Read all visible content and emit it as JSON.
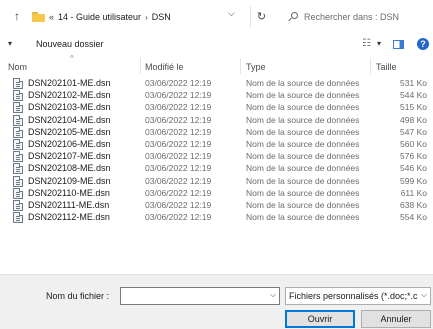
{
  "address": {
    "overflow": "«",
    "crumbs": [
      "14 - Guide utilisateur",
      "DSN"
    ]
  },
  "search": {
    "placeholder": "Rechercher dans : DSN"
  },
  "toolbar": {
    "new_folder": "Nouveau dossier",
    "help": "?"
  },
  "columns": {
    "name": "Nom",
    "modified": "Modifié le",
    "type": "Type",
    "size": "Taille"
  },
  "files": [
    {
      "name": "DSN202101-ME.dsn",
      "modified": "03/06/2022 12:19",
      "type": "Nom de la source de données",
      "size": "531 Ko"
    },
    {
      "name": "DSN202102-ME.dsn",
      "modified": "03/06/2022 12:19",
      "type": "Nom de la source de données",
      "size": "544 Ko"
    },
    {
      "name": "DSN202103-ME.dsn",
      "modified": "03/06/2022 12:19",
      "type": "Nom de la source de données",
      "size": "515 Ko"
    },
    {
      "name": "DSN202104-ME.dsn",
      "modified": "03/06/2022 12:19",
      "type": "Nom de la source de données",
      "size": "498 Ko"
    },
    {
      "name": "DSN202105-ME.dsn",
      "modified": "03/06/2022 12:19",
      "type": "Nom de la source de données",
      "size": "547 Ko"
    },
    {
      "name": "DSN202106-ME.dsn",
      "modified": "03/06/2022 12:19",
      "type": "Nom de la source de données",
      "size": "560 Ko"
    },
    {
      "name": "DSN202107-ME.dsn",
      "modified": "03/06/2022 12:19",
      "type": "Nom de la source de données",
      "size": "576 Ko"
    },
    {
      "name": "DSN202108-ME.dsn",
      "modified": "03/06/2022 12:19",
      "type": "Nom de la source de données",
      "size": "546 Ko"
    },
    {
      "name": "DSN202109-ME.dsn",
      "modified": "03/06/2022 12:19",
      "type": "Nom de la source de données",
      "size": "599 Ko"
    },
    {
      "name": "DSN202110-ME.dsn",
      "modified": "03/06/2022 12:19",
      "type": "Nom de la source de données",
      "size": "611 Ko"
    },
    {
      "name": "DSN202111-ME.dsn",
      "modified": "03/06/2022 12:19",
      "type": "Nom de la source de données",
      "size": "638 Ko"
    },
    {
      "name": "DSN202112-ME.dsn",
      "modified": "03/06/2022 12:19",
      "type": "Nom de la source de données",
      "size": "554 Ko"
    }
  ],
  "footer": {
    "filename_label": "Nom du fichier :",
    "filename_value": "",
    "filter": "Fichiers personnalisés (*.doc;*.c",
    "open": "Ouvrir",
    "cancel": "Annuler"
  },
  "icons": {
    "up": "up-arrow-icon",
    "folder": "folder-icon",
    "refresh": "refresh-icon",
    "search": "search-icon",
    "file": "data-source-file-icon"
  },
  "colors": {
    "accent": "#0078d7",
    "folder": "#f5c84c",
    "help": "#2566c9"
  }
}
